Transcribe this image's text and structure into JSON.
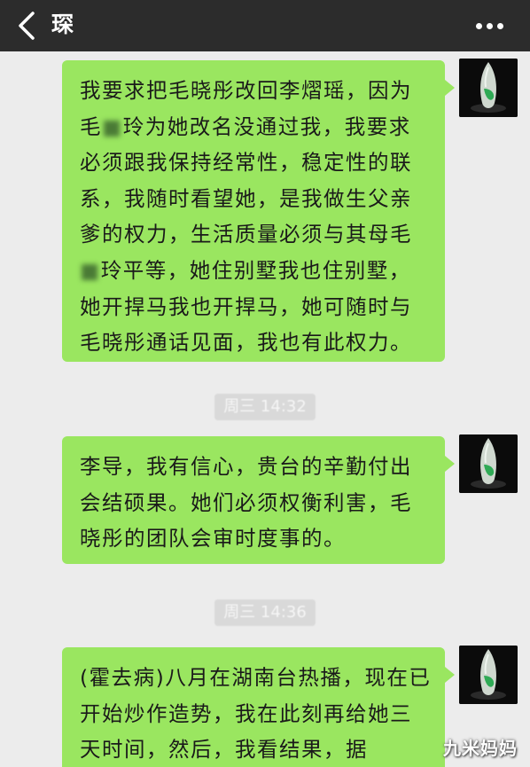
{
  "header": {
    "title": "琛",
    "back_icon": "chevron-left-icon",
    "more_icon": "more-horizontal-icon"
  },
  "messages": [
    {
      "text": "我要求把毛晓彤改回李熠瑶，因为毛■玲为她改名没通过我，我要求必须跟我保持经常性，稳定性的联系，我随时看望她，是我做生父亲爹的权力，生活质量必须与其母毛■玲平等，她住别墅我也住别墅，她开捍马我也开捍马，她可随时与毛晓彤通话见面，我也有此权力。"
    },
    {
      "text": "李导，我有信心，贵台的辛勤付出会结硕果。她们必须权衡利害，毛晓彤的团队会审时度事的。"
    },
    {
      "text": "(霍去病)八月在湖南台热播，现在已开始炒作造势，我在此刻再给她三天时间，然后，我看结果，据"
    }
  ],
  "timestamps": [
    "周三 14:32",
    "周三 14:36"
  ],
  "watermark": "九米妈妈",
  "colors": {
    "header_bg": "#2c2c2c",
    "chat_bg": "#ececec",
    "bubble_bg": "#9ae660"
  }
}
